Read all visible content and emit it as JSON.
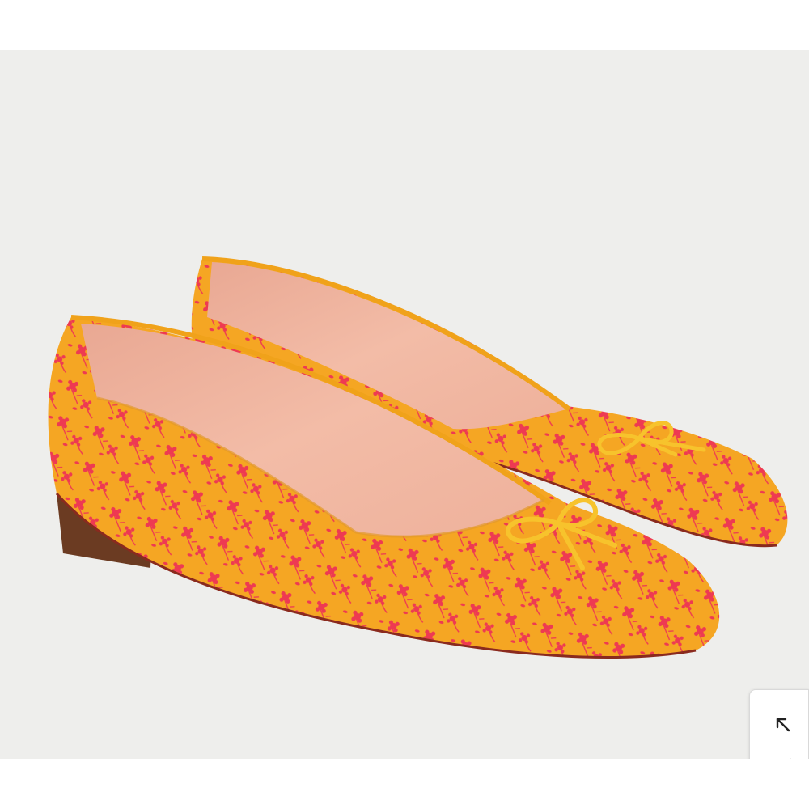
{
  "image": {
    "subject": "product-photo-ballet-flats",
    "colors": {
      "background": "#eeeeec",
      "upper": "#f5a623",
      "flower": "#ee3a52",
      "lining": "#f2b8a2",
      "heel": "#6b3b22",
      "sole": "#8a2a1e"
    }
  },
  "controls": {
    "expand_icon": "expand-arrows-icon"
  }
}
